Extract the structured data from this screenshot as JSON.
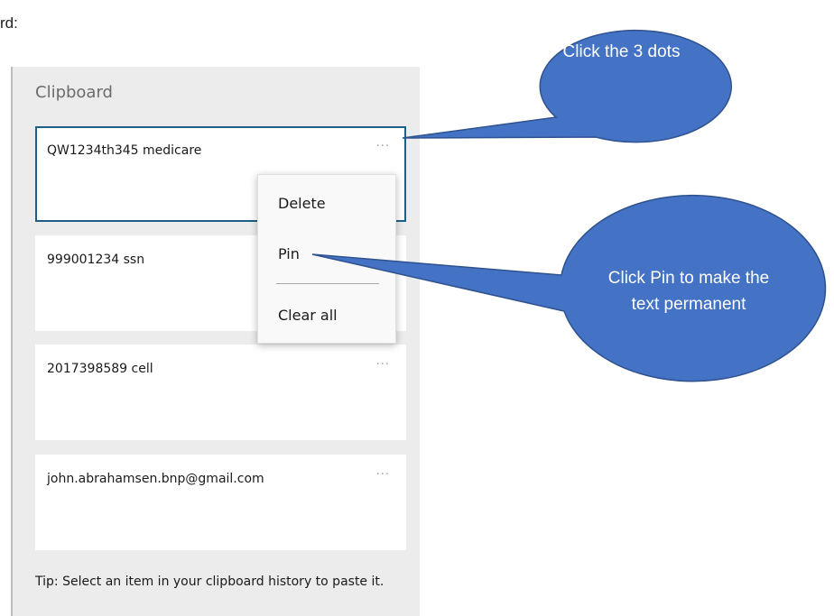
{
  "document": {
    "fragment": "rd:"
  },
  "clipboard": {
    "title": "Clipboard",
    "items": [
      {
        "text": "QW1234th345 medicare",
        "more": "···",
        "selected": true
      },
      {
        "text": "999001234 ssn",
        "more": "···",
        "selected": false
      },
      {
        "text": "2017398589 cell",
        "more": "···",
        "selected": false
      },
      {
        "text": "john.abrahamsen.bnp@gmail.com",
        "more": "···",
        "selected": false
      }
    ],
    "tip": "Tip: Select an item in your clipboard history to paste it."
  },
  "context_menu": {
    "items": [
      {
        "label": "Delete"
      },
      {
        "label": "Pin"
      },
      {
        "label": "Clear all"
      }
    ]
  },
  "callouts": [
    {
      "text": "Click the 3 dots"
    },
    {
      "text": "Click Pin to make the text permanent"
    }
  ],
  "colors": {
    "callout_fill": "#4472c4",
    "callout_stroke": "#2f528f",
    "selection_border": "#1e5f87",
    "panel_background": "#ececec"
  }
}
